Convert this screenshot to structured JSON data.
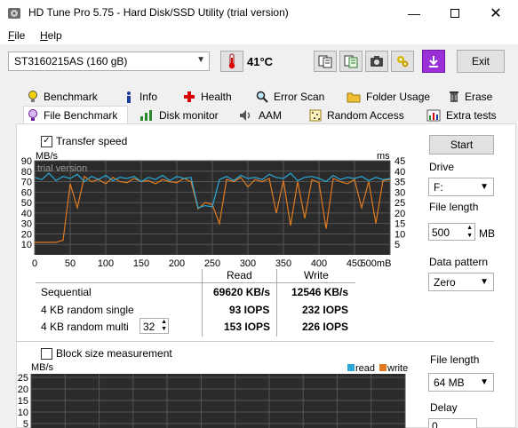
{
  "window": {
    "title": "HD Tune Pro 5.75 - Hard Disk/SSD Utility (trial version)"
  },
  "menu": {
    "file": "File",
    "help": "Help"
  },
  "toolbar": {
    "drive": "ST3160215AS (160 gB)",
    "temperature": "41°C",
    "exit_label": "Exit"
  },
  "tabs_top": [
    {
      "label": "Benchmark",
      "icon": "benchmark-icon"
    },
    {
      "label": "Info",
      "icon": "info-icon"
    },
    {
      "label": "Health",
      "icon": "health-icon"
    },
    {
      "label": "Error Scan",
      "icon": "error-scan-icon"
    },
    {
      "label": "Folder Usage",
      "icon": "folder-icon"
    },
    {
      "label": "Erase",
      "icon": "erase-icon"
    }
  ],
  "tabs_bottom": [
    {
      "label": "File Benchmark",
      "icon": "file-benchmark-icon"
    },
    {
      "label": "Disk monitor",
      "icon": "disk-monitor-icon"
    },
    {
      "label": "AAM",
      "icon": "speaker-icon"
    },
    {
      "label": "Random Access",
      "icon": "random-access-icon"
    },
    {
      "label": "Extra tests",
      "icon": "extra-tests-icon"
    }
  ],
  "transfer": {
    "checkbox_label": "Transfer speed",
    "checked": true
  },
  "chart_data": [
    {
      "type": "line",
      "watermark": "trial version",
      "ylabel_left": "MB/s",
      "ylabel_right": "ms",
      "y_left_ticks": [
        10,
        20,
        30,
        40,
        50,
        60,
        70,
        80,
        90
      ],
      "y_right_ticks": [
        5,
        10,
        15,
        20,
        25,
        30,
        35,
        40,
        45
      ],
      "x_ticks": [
        "0",
        "50",
        "100",
        "150",
        "200",
        "250",
        "300",
        "350",
        "400",
        "450",
        "500mB"
      ],
      "ylim_left": [
        0,
        90
      ],
      "xlim": [
        0,
        500
      ],
      "colors": {
        "read": "#2aa7d6",
        "write": "#e07a1f",
        "background": "#2b2b2b",
        "grid": "#555555"
      },
      "series": [
        {
          "name": "read",
          "x": [
            0,
            10,
            20,
            30,
            40,
            50,
            60,
            70,
            80,
            90,
            100,
            110,
            120,
            130,
            140,
            150,
            160,
            170,
            180,
            190,
            200,
            210,
            220,
            230,
            240,
            250,
            260,
            270,
            280,
            290,
            300,
            310,
            320,
            330,
            340,
            350,
            360,
            370,
            380,
            390,
            400,
            410,
            420,
            430,
            440,
            450,
            460,
            470,
            480,
            490,
            500
          ],
          "y": [
            74,
            72,
            78,
            71,
            75,
            73,
            77,
            70,
            75,
            72,
            76,
            71,
            74,
            73,
            75,
            70,
            74,
            72,
            76,
            71,
            75,
            73,
            74,
            45,
            47,
            46,
            72,
            75,
            71,
            76,
            73,
            74,
            72,
            77,
            74,
            73,
            78,
            71,
            74,
            75,
            73,
            70,
            76,
            72,
            74,
            73,
            75,
            71,
            74,
            72,
            73
          ]
        },
        {
          "name": "write",
          "x": [
            0,
            10,
            20,
            30,
            40,
            50,
            60,
            70,
            80,
            90,
            100,
            110,
            120,
            130,
            140,
            150,
            160,
            170,
            180,
            190,
            200,
            210,
            220,
            230,
            240,
            250,
            260,
            270,
            280,
            290,
            300,
            310,
            320,
            330,
            340,
            350,
            360,
            370,
            380,
            390,
            400,
            410,
            420,
            430,
            440,
            450,
            460,
            470,
            480,
            490,
            500
          ],
          "y": [
            12,
            12,
            12,
            12,
            14,
            68,
            45,
            75,
            70,
            72,
            68,
            74,
            70,
            69,
            73,
            70,
            71,
            68,
            72,
            70,
            69,
            73,
            70,
            44,
            50,
            48,
            30,
            72,
            70,
            74,
            65,
            72,
            70,
            73,
            40,
            71,
            28,
            70,
            35,
            72,
            69,
            25,
            73,
            70,
            68,
            72,
            45,
            70,
            30,
            71,
            72
          ]
        }
      ]
    },
    {
      "type": "bar",
      "ylabel": "MB/s",
      "y_ticks": [
        25,
        20,
        15,
        10,
        5
      ],
      "legend": [
        "read",
        "write"
      ],
      "legend_position": "top-right",
      "colors": {
        "read": "#2aa7d6",
        "write": "#e07a1f"
      },
      "ylim": [
        0,
        25
      ]
    }
  ],
  "results": {
    "col_read": "Read",
    "col_write": "Write",
    "rows": [
      {
        "label": "Sequential",
        "read": "69620 KB/s",
        "write": "12546 KB/s"
      },
      {
        "label": "4 KB random single",
        "read": "93 IOPS",
        "write": "232 IOPS"
      },
      {
        "label": "4 KB random multi",
        "read": "153 IOPS",
        "write": "226 IOPS",
        "spin": "32"
      }
    ]
  },
  "right_panel": {
    "start_label": "Start",
    "drive_label": "Drive",
    "drive_value": "F:",
    "file_length_label": "File length",
    "file_length_value": "500",
    "file_length_unit": "MB",
    "pattern_label": "Data pattern",
    "pattern_value": "Zero"
  },
  "block": {
    "checkbox_label": "Block size measurement",
    "checked": false,
    "file_length_label": "File length",
    "file_length_value": "64 MB",
    "delay_label": "Delay",
    "delay_value": "0"
  }
}
